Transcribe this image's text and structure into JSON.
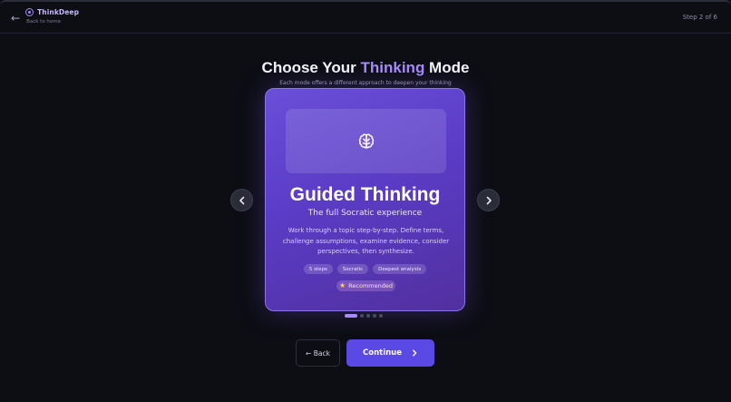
{
  "header": {
    "brand_name": "ThinkDeep",
    "back_link": "Back to home",
    "back_arrow": "←",
    "step": "Step 2 of 6"
  },
  "page": {
    "title_prefix": "Choose Your ",
    "title_accent": "Thinking",
    "title_suffix": " Mode",
    "subtitle": "Each mode offers a different approach to deepen your thinking"
  },
  "carousel": {
    "current_index": 1,
    "total": 5,
    "card": {
      "icon": "brain-icon",
      "title": "Guided Thinking",
      "tagline": "The full Socratic experience",
      "description": "Work through a topic step-by-step. Define terms, challenge assumptions, examine evidence, consider perspectives, then synthesize.",
      "tags": [
        "5 steps",
        "Socratic",
        "Deepest analysis"
      ],
      "badge_icon": "star-icon",
      "badge": "Recommended"
    }
  },
  "actions": {
    "back_label": "← Back",
    "continue_label": "Continue"
  },
  "colors": {
    "accent": "#a78bfa",
    "card": "#5a3cc6",
    "primary_button": "#5b49e6",
    "background": "#0d0d14"
  }
}
